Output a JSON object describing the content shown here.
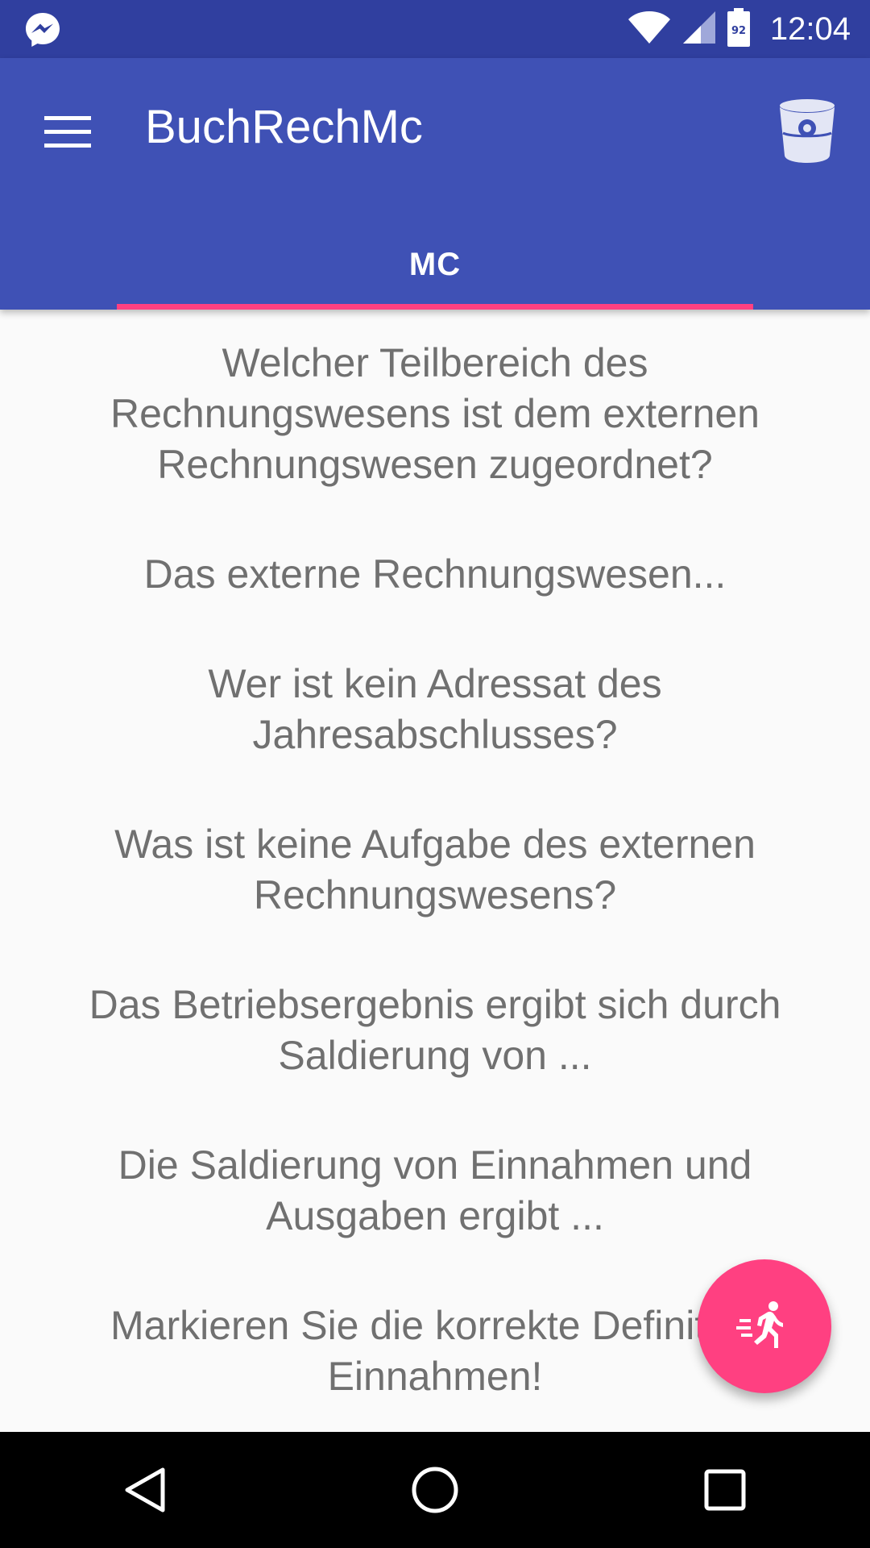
{
  "status_bar": {
    "time": "12:04",
    "battery_level": "92",
    "notification_icon": "messenger-icon"
  },
  "app_bar": {
    "title": "BuchRechMc",
    "menu_icon": "hamburger-menu-icon",
    "action_icon": "bin-icon"
  },
  "tabs": [
    {
      "label": "MC",
      "selected": true
    }
  ],
  "questions": [
    "Welcher Teilbereich des Rechnungswesens ist dem externen Rechnungswesen zugeordnet?",
    "Das externe Rechnungswesen...",
    "Wer ist kein Adressat des Jahresabschlusses?",
    "Was ist keine Aufgabe des externen Rechnungswesens?",
    "Das Betriebsergebnis ergibt sich durch Saldierung von ...",
    "Die Saldierung von Einnahmen und Ausgaben ergibt ...",
    "Markieren Sie die korrekte Definition Einnahmen!"
  ],
  "fab": {
    "icon": "running-person-icon"
  },
  "colors": {
    "status_bar": "#303f9f",
    "primary": "#3f51b5",
    "accent": "#ff4081",
    "text": "#707070",
    "background": "#fafafa"
  }
}
